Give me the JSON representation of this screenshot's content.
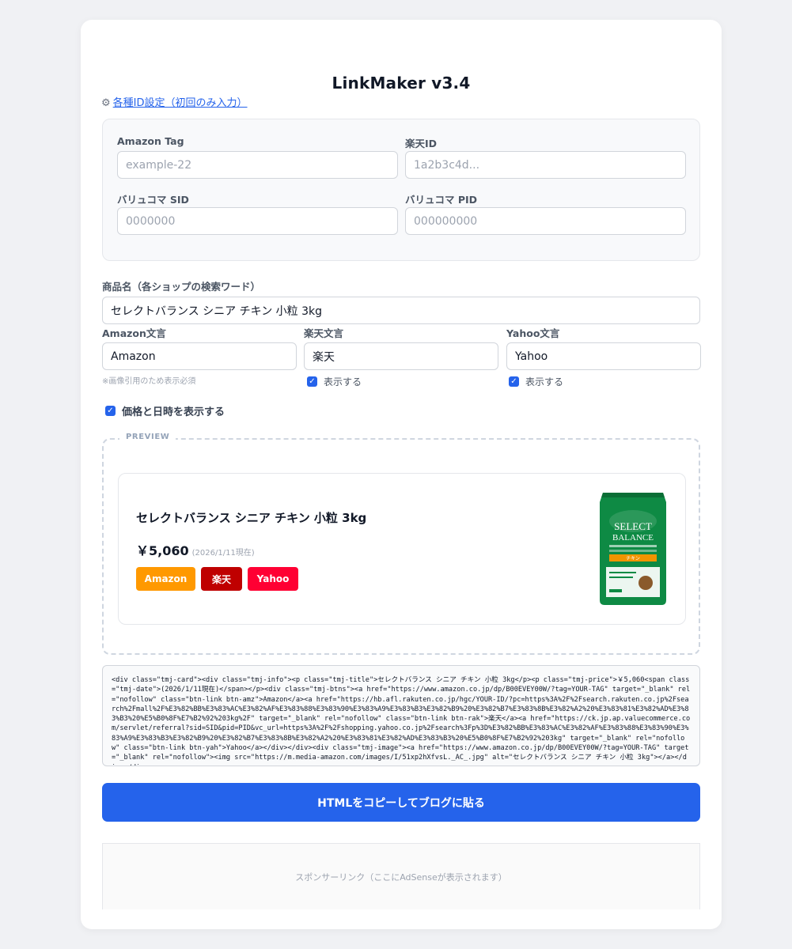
{
  "app": {
    "title": "LinkMaker v3.4"
  },
  "settings_link": {
    "icon": "gear-icon",
    "label": "各種ID設定（初回のみ入力）"
  },
  "ids": {
    "amazon_tag": {
      "label": "Amazon Tag",
      "placeholder": "example-22"
    },
    "rakuten_id": {
      "label": "楽天ID",
      "placeholder": "1a2b3c4d..."
    },
    "vc_sid": {
      "label": "バリュコマ SID",
      "placeholder": "0000000"
    },
    "vc_pid": {
      "label": "バリュコマ PID",
      "placeholder": "000000000"
    }
  },
  "product": {
    "label": "商品名（各ショップの検索ワード）",
    "value": "セレクトバランス シニア チキン 小粒 3kg"
  },
  "texts": {
    "amazon": {
      "label": "Amazon文言",
      "value": "Amazon",
      "note": "※画像引用のため表示必須"
    },
    "rakuten": {
      "label": "楽天文言",
      "value": "楽天",
      "show_label": "表示する",
      "checked": true
    },
    "yahoo": {
      "label": "Yahoo文言",
      "value": "Yahoo",
      "show_label": "表示する",
      "checked": true
    }
  },
  "price_toggle": {
    "label": "価格と日時を表示する",
    "checked": true
  },
  "preview": {
    "tag": "PREVIEW",
    "title": "セレクトバランス シニア チキン 小粒 3kg",
    "price": "￥5,060",
    "date": "(2026/1/11現在)",
    "buttons": [
      {
        "label": "Amazon",
        "color": "#ff9900"
      },
      {
        "label": "楽天",
        "color": "#bf0000"
      },
      {
        "label": "Yahoo",
        "color": "#ff0033"
      }
    ],
    "image": {
      "brand_line1": "SELECT",
      "brand_line2": "BALANCE",
      "flavor": "チキン"
    }
  },
  "code": "<div class=\"tmj-card\"><div class=\"tmj-info\"><p class=\"tmj-title\">セレクトバランス シニア チキン 小粒 3kg</p><p class=\"tmj-price\">￥5,060<span class=\"tmj-date\">(2026/1/11現在)</span></p><div class=\"tmj-btns\"><a href=\"https://www.amazon.co.jp/dp/B00EVEY00W/?tag=YOUR-TAG\" target=\"_blank\" rel=\"nofollow\" class=\"btn-link btn-amz\">Amazon</a><a href=\"https://hb.afl.rakuten.co.jp/hgc/YOUR-ID/?pc=https%3A%2F%2Fsearch.rakuten.co.jp%2Fsearch%2Fmall%2F%E3%82%BB%E3%83%AC%E3%82%AF%E3%83%88%E3%83%90%E3%83%A9%E3%83%B3%E3%82%B9%20%E3%82%B7%E3%83%8B%E3%82%A2%20%E3%83%81%E3%82%AD%E3%83%B3%20%E5%B0%8F%E7%B2%92%203kg%2F\" target=\"_blank\" rel=\"nofollow\" class=\"btn-link btn-rak\">楽天</a><a href=\"https://ck.jp.ap.valuecommerce.com/servlet/referral?sid=SID&pid=PID&vc_url=https%3A%2F%2Fshopping.yahoo.co.jp%2Fsearch%3Fp%3D%E3%82%BB%E3%83%AC%E3%82%AF%E3%83%88%E3%83%90%E3%83%A9%E3%83%B3%E3%82%B9%20%E3%82%B7%E3%83%8B%E3%82%A2%20%E3%83%81%E3%82%AD%E3%83%B3%20%E5%B0%8F%E7%B2%92%203kg\" target=\"_blank\" rel=\"nofollow\" class=\"btn-link btn-yah\">Yahoo</a></div></div><div class=\"tmj-image\"><a href=\"https://www.amazon.co.jp/dp/B00EVEY00W/?tag=YOUR-TAG\" target=\"_blank\" rel=\"nofollow\"><img src=\"https://m.media-amazon.com/images/I/51xp2hXfvsL._AC_.jpg\" alt=\"セレクトバランス シニア チキン 小粒 3kg\"></a></div></div>",
  "copy_button": "HTMLをコピーしてブログに貼る",
  "ad": "スポンサーリンク（ここにAdSenseが表示されます）"
}
